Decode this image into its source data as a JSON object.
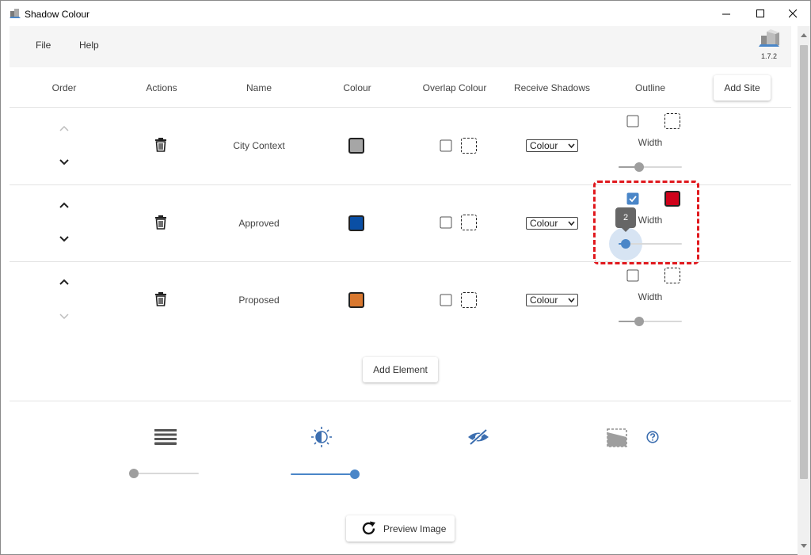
{
  "window": {
    "title": "Shadow Colour"
  },
  "menu": {
    "file": "File",
    "help": "Help",
    "version": "1.7.2"
  },
  "table": {
    "headers": {
      "order": "Order",
      "actions": "Actions",
      "name": "Name",
      "colour": "Colour",
      "overlap_colour": "Overlap Colour",
      "receive_shadows": "Receive Shadows",
      "outline": "Outline"
    },
    "add_site_label": "Add Site",
    "rows": [
      {
        "name": "City Context",
        "colour": "#a6a6a6",
        "overlap_checked": false,
        "receive_shadows": "Colour",
        "outline_checked": false,
        "outline_colour": null,
        "width_label": "Width",
        "width_value": 2,
        "up_enabled": false,
        "down_enabled": true
      },
      {
        "name": "Approved",
        "colour": "#0a4fa5",
        "overlap_checked": false,
        "receive_shadows": "Colour",
        "outline_checked": true,
        "outline_colour": "#d0021b",
        "width_label": "Width",
        "width_value": 2,
        "width_tooltip": "2",
        "up_enabled": true,
        "down_enabled": true
      },
      {
        "name": "Proposed",
        "colour": "#d9782f",
        "overlap_checked": false,
        "receive_shadows": "Colour",
        "outline_checked": false,
        "outline_colour": null,
        "width_label": "Width",
        "width_value": 2,
        "up_enabled": true,
        "down_enabled": false
      }
    ]
  },
  "add_element_label": "Add Element",
  "bottom_sliders": {
    "layers_value": 0,
    "brightness_value": 1
  },
  "preview_label": "Preview Image",
  "colors": {
    "accent": "#4a86c8",
    "highlight": "#e0191e",
    "disabled": "#9e9e9e"
  }
}
